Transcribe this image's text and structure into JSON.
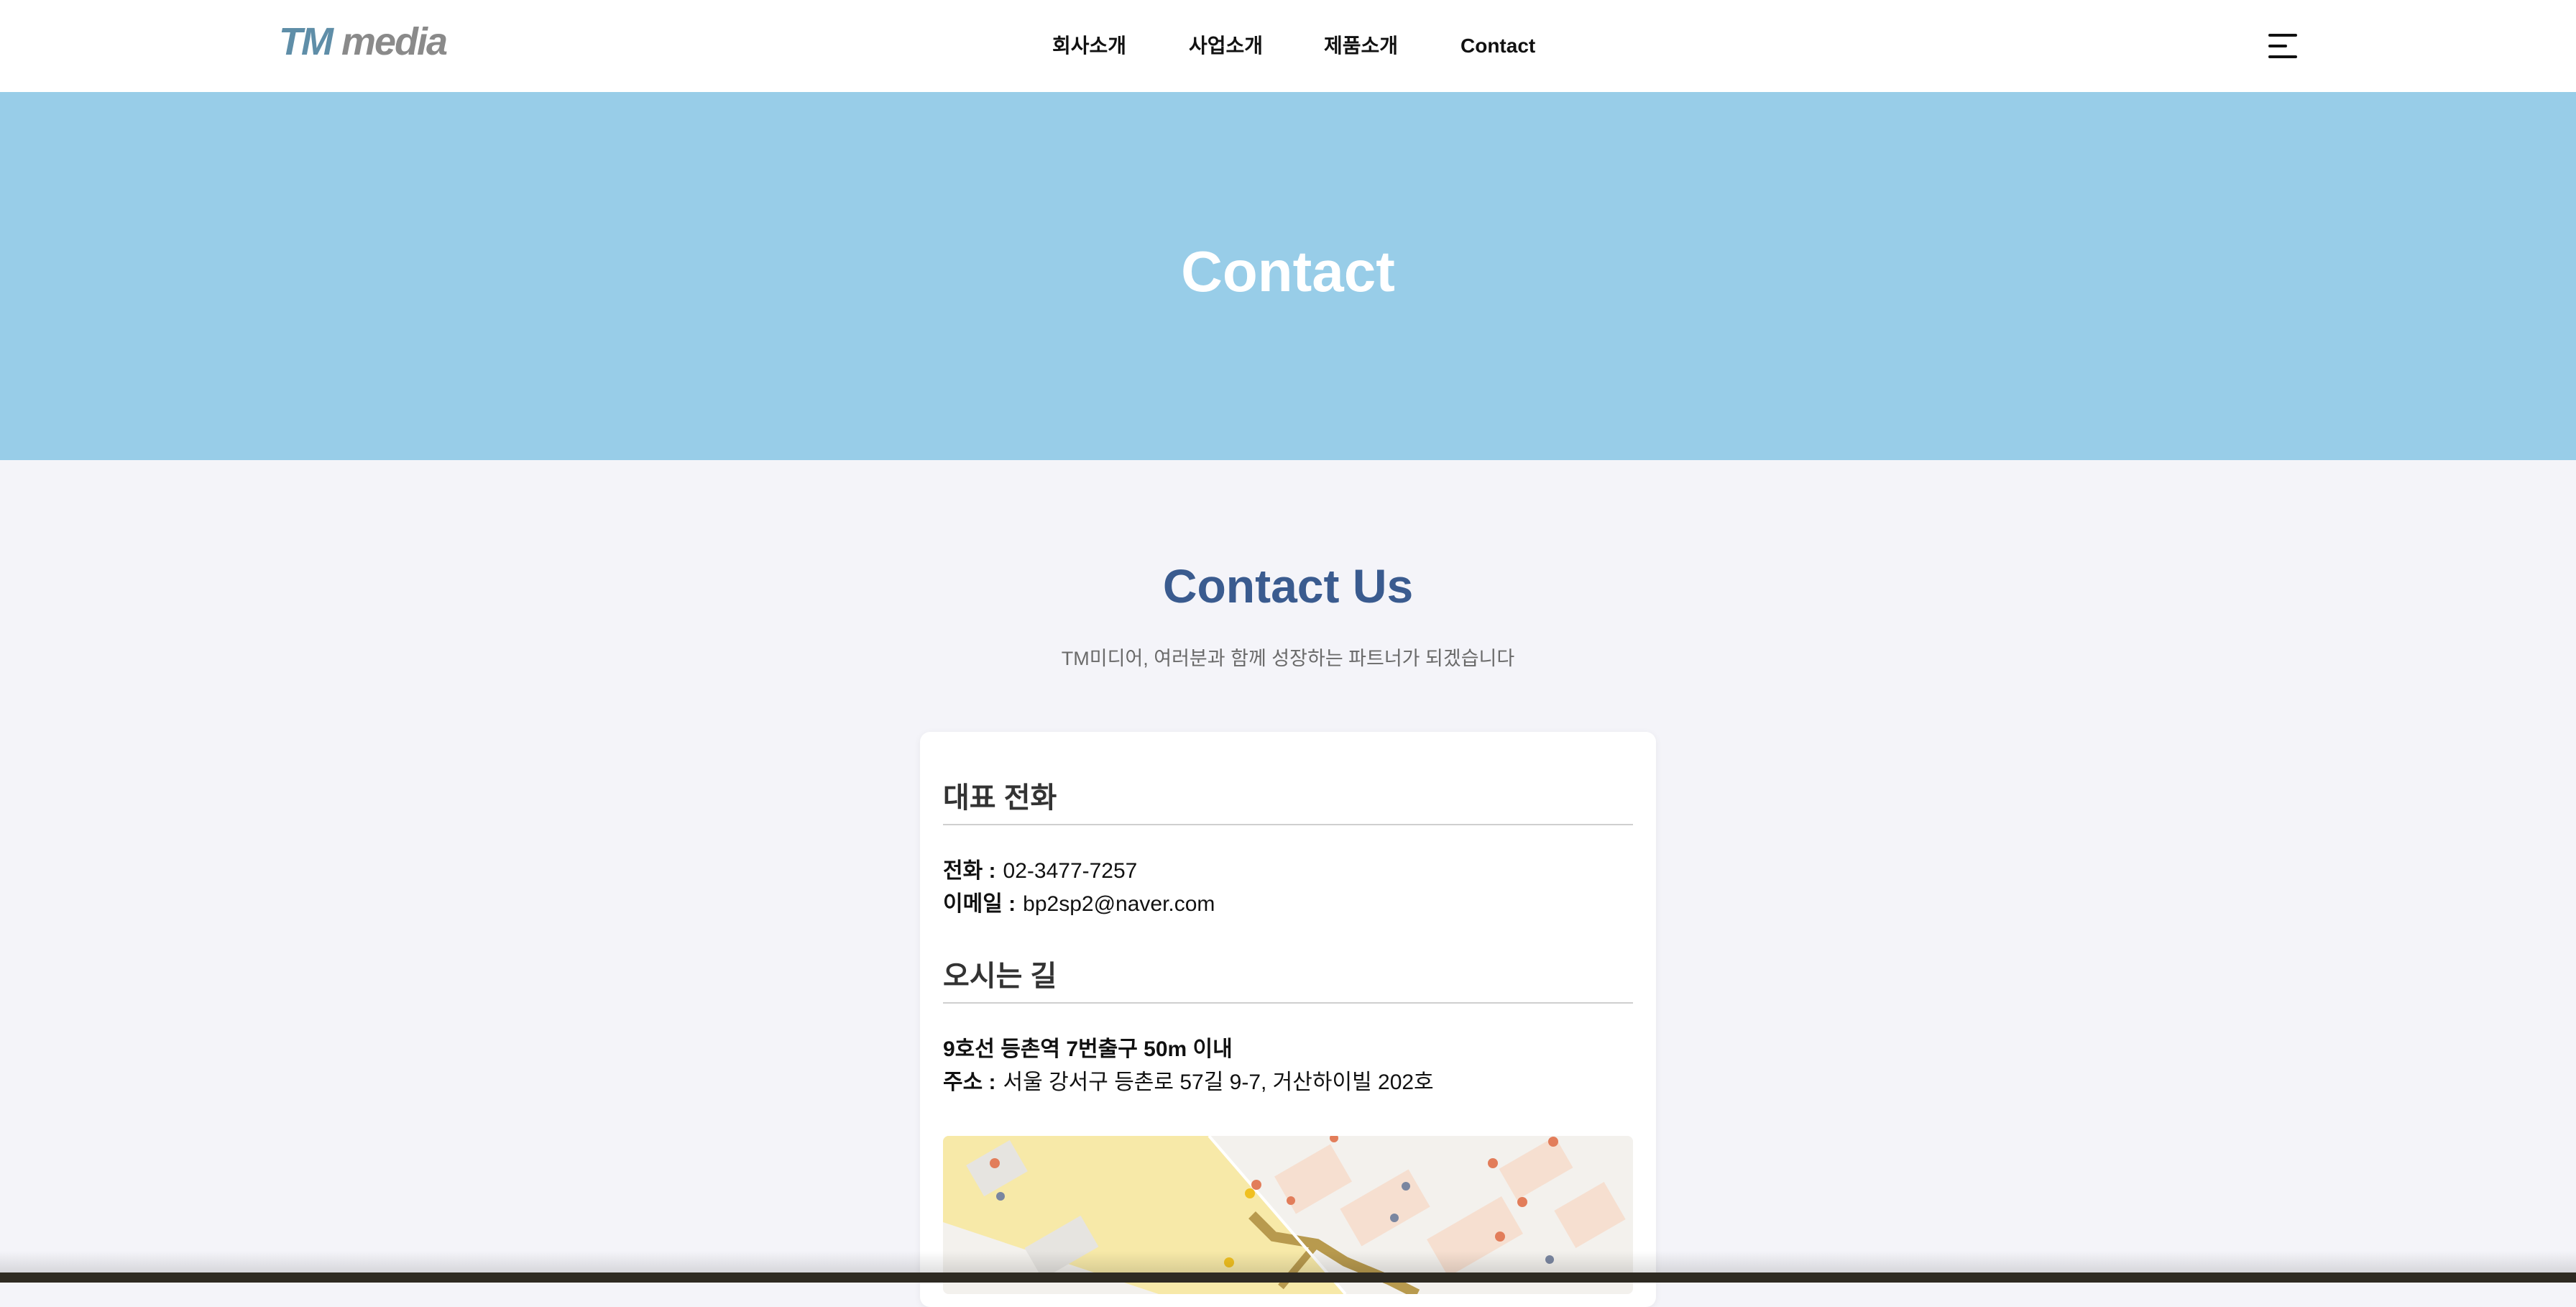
{
  "header": {
    "logo_tm": "TM",
    "logo_media": "media",
    "nav": [
      "회사소개",
      "사업소개",
      "제품소개",
      "Contact"
    ]
  },
  "hero": {
    "title": "Contact"
  },
  "section": {
    "title": "Contact Us",
    "subtitle": "TM미디어, 여러분과 함께 성장하는 파트너가 되겠습니다"
  },
  "phone_block": {
    "heading": "대표 전화",
    "phone_label": "전화 :",
    "phone_value": "02-3477-7257",
    "email_label": "이메일 :",
    "email_value": "bp2sp2@naver.com"
  },
  "directions": {
    "heading": "오시는 길",
    "subway": "9호선 등촌역 7번출구 50m 이내",
    "address_label": "주소 :",
    "address_value": "서울 강서구 등촌로 57길 9-7, 거산하이빌 202호"
  },
  "colors": {
    "hero_bg": "#98cde8",
    "title_blue": "#3a5b8f",
    "logo_tm": "#5f8ea8",
    "page_bg": "#f4f4f9"
  },
  "icons": {
    "menu": "hamburger-menu-icon"
  }
}
